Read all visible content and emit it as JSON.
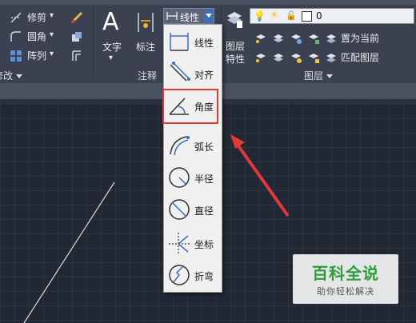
{
  "ribbon": {
    "modify": {
      "trim": "修剪",
      "fillet": "圆角",
      "array": "阵列",
      "group_label": "修改"
    },
    "annotation": {
      "text": "文字",
      "dimension": "标注",
      "linear": "线性",
      "group_label": "注释"
    },
    "layers": {
      "layer_properties": "图层\n特性",
      "set_current": "置为当前",
      "match_layer": "匹配图层",
      "layer_value": "0",
      "group_label": "图层"
    }
  },
  "dropdown": {
    "items": [
      {
        "label": "线性",
        "icon": "linear-dim-icon"
      },
      {
        "label": "对齐",
        "icon": "aligned-dim-icon"
      },
      {
        "label": "角度",
        "icon": "angular-dim-icon"
      },
      {
        "label": "弧长",
        "icon": "arc-length-dim-icon"
      },
      {
        "label": "半径",
        "icon": "radius-dim-icon"
      },
      {
        "label": "直径",
        "icon": "diameter-dim-icon"
      },
      {
        "label": "坐标",
        "icon": "ordinate-dim-icon"
      },
      {
        "label": "折弯",
        "icon": "jogged-dim-icon"
      }
    ],
    "highlighted": "角度"
  },
  "watermark": {
    "title": "百科全说",
    "subtitle": "助你轻松解决"
  },
  "colors": {
    "highlight_border": "#e0393a",
    "arrow": "#e0393a",
    "watermark_green": "#2e9c3b"
  }
}
